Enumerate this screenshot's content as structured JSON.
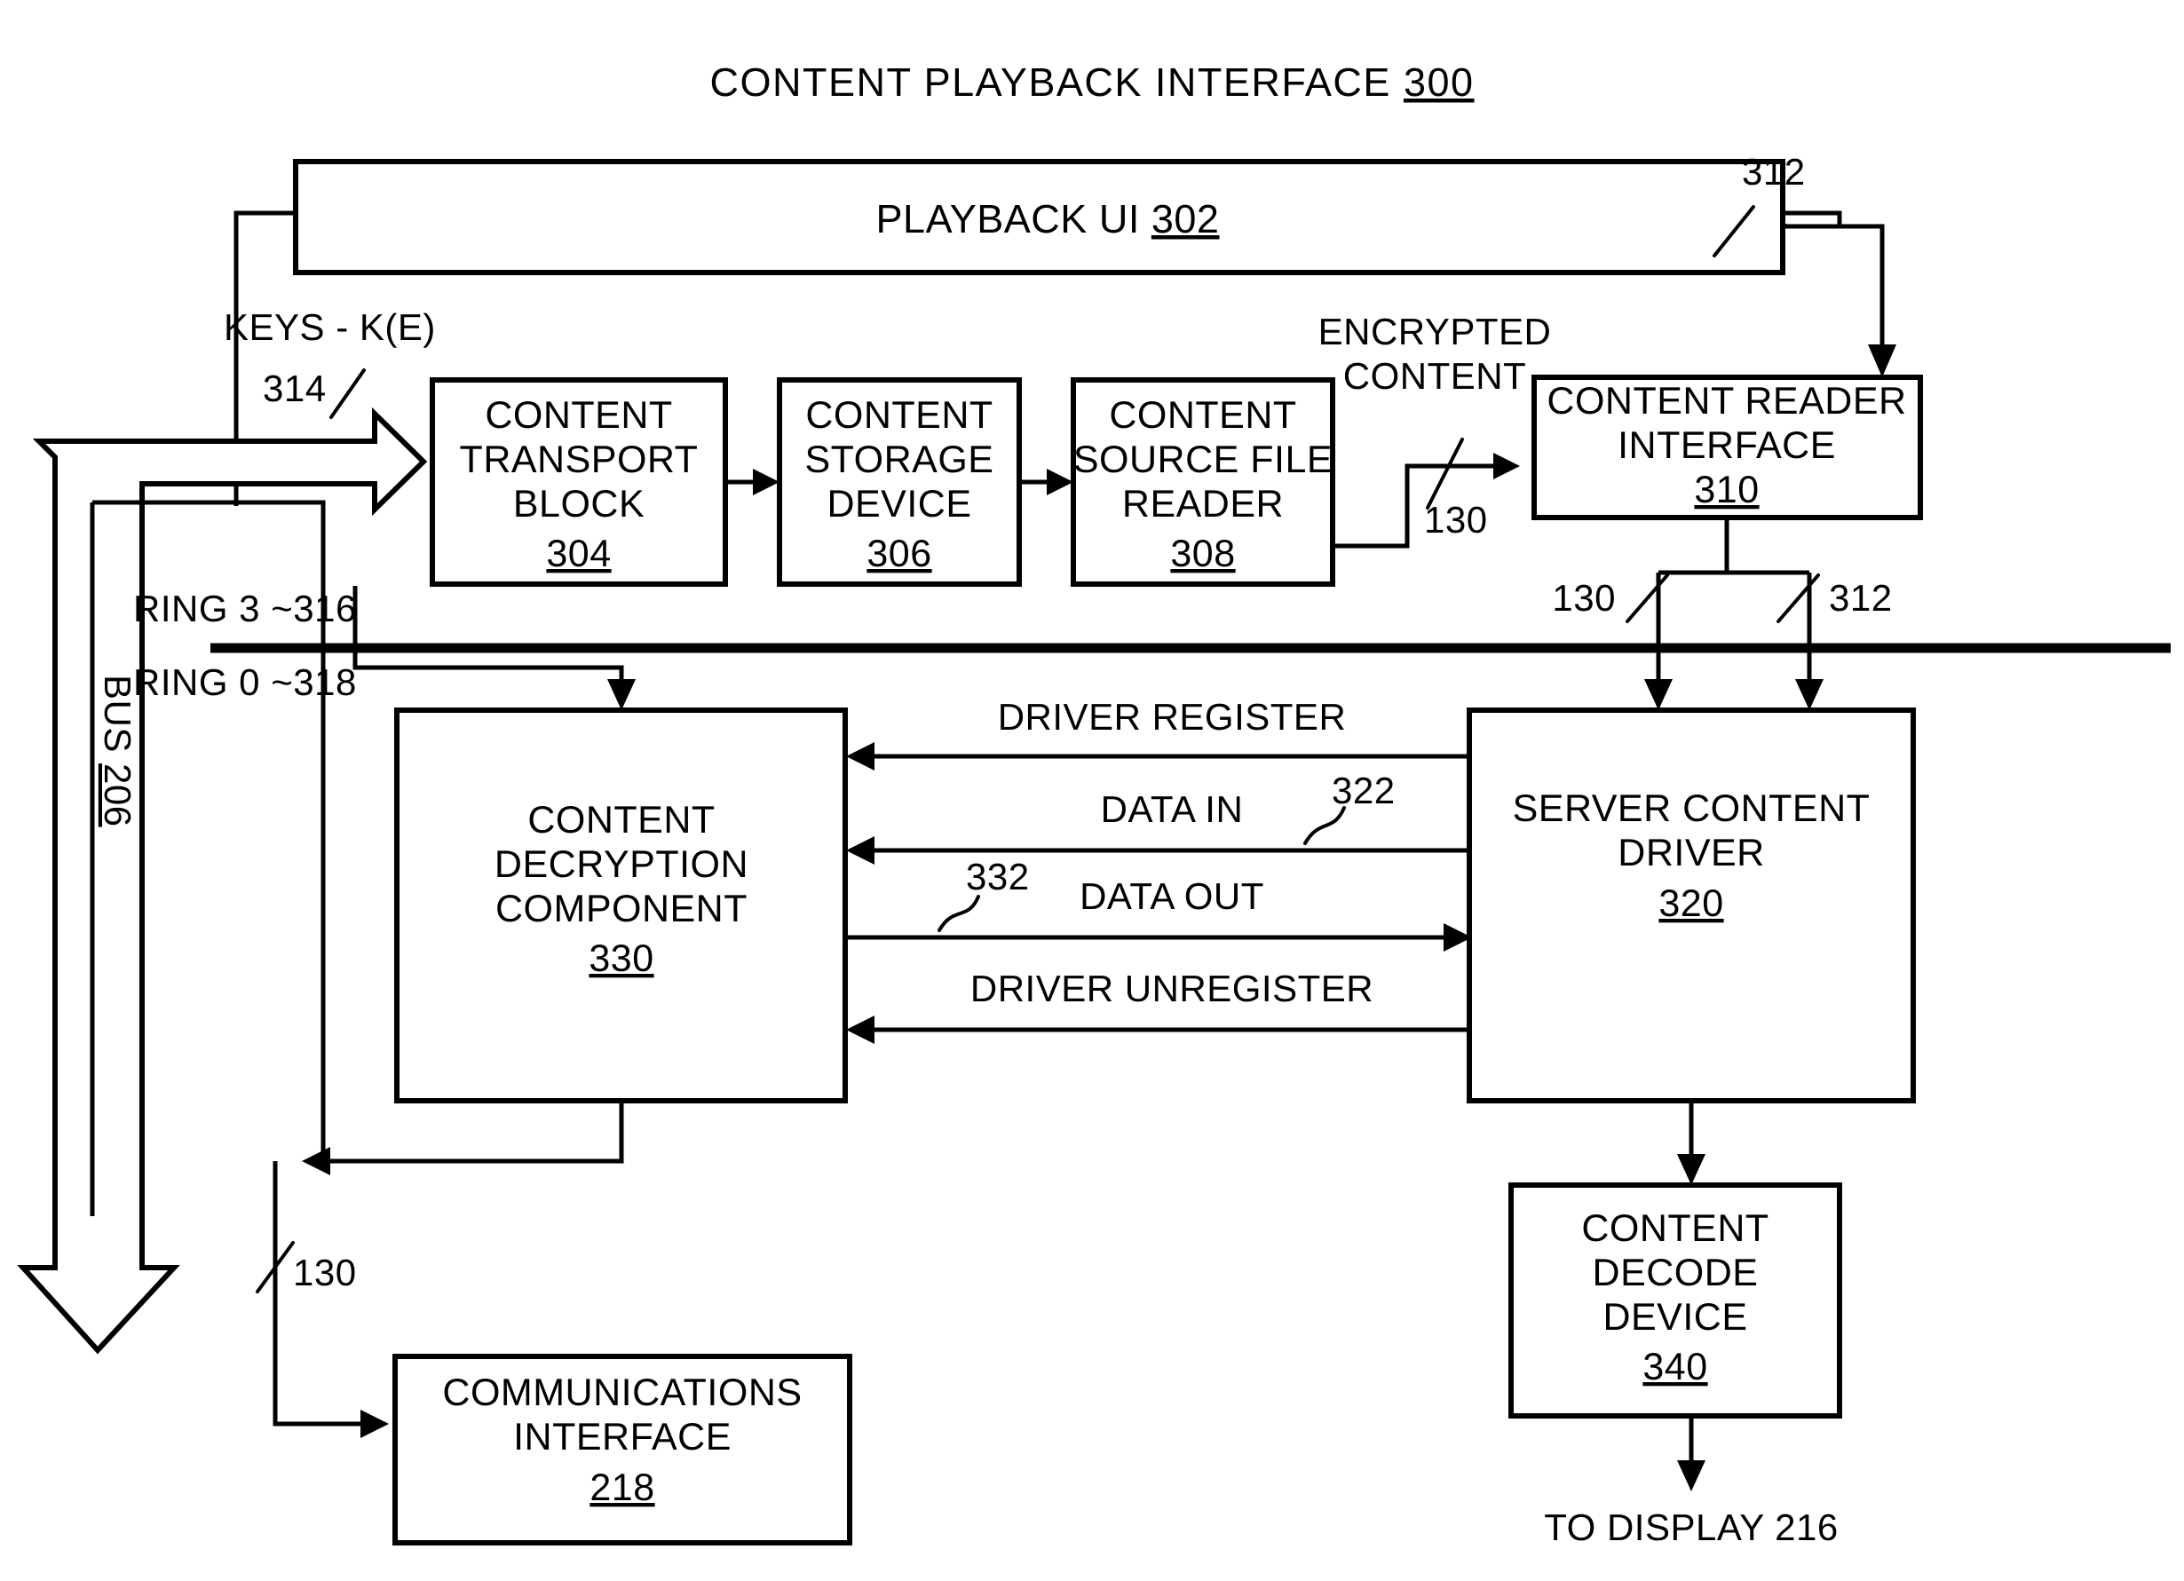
{
  "figure": {
    "title_text": "CONTENT PLAYBACK INTERFACE",
    "title_ref": "300"
  },
  "boxes": {
    "playback_ui": {
      "label": "PLAYBACK UI",
      "ref": "302"
    },
    "content_transport_block": {
      "line1": "CONTENT",
      "line2": "TRANSPORT",
      "line3": "BLOCK",
      "ref": "304"
    },
    "content_storage_device": {
      "line1": "CONTENT",
      "line2": "STORAGE",
      "line3": "DEVICE",
      "ref": "306"
    },
    "content_source_file_reader": {
      "line1": "CONTENT",
      "line2": "SOURCE FILE",
      "line3": "READER",
      "ref": "308"
    },
    "content_reader_interface": {
      "line1": "CONTENT READER",
      "line2": "INTERFACE",
      "ref": "310"
    },
    "content_decryption_component": {
      "line1": "CONTENT",
      "line2": "DECRYPTION",
      "line3": "COMPONENT",
      "ref": "330"
    },
    "server_content_driver": {
      "line1": "SERVER CONTENT",
      "line2": "DRIVER",
      "ref": "320"
    },
    "content_decode_device": {
      "line1": "CONTENT",
      "line2": "DECODE",
      "line3": "DEVICE",
      "ref": "340"
    },
    "communications_interface": {
      "line1": "COMMUNICATIONS",
      "line2": "INTERFACE",
      "ref": "218"
    }
  },
  "labels": {
    "keys": "KEYS - K(E)",
    "keys_ref": "314",
    "encrypted_content_l1": "ENCRYPTED",
    "encrypted_content_l2": "CONTENT",
    "encrypted_ref": "130",
    "playback_ui_ref_312": "312",
    "ring3": "RING 3 ~316",
    "ring0": "RING 0 ~318",
    "bus_text": "BUS",
    "bus_ref": "206",
    "driver_ref_130": "130",
    "driver_ref_312": "312",
    "comms_ref_130": "130",
    "to_display": "TO DISPLAY 216"
  },
  "signals": [
    {
      "name": "driver-register",
      "label": "DRIVER REGISTER",
      "direction": "left",
      "ref": ""
    },
    {
      "name": "data-in",
      "label": "DATA IN",
      "direction": "left",
      "ref": "322"
    },
    {
      "name": "data-out",
      "label": "DATA OUT",
      "direction": "right",
      "ref": "332"
    },
    {
      "name": "driver-unregister",
      "label": "DRIVER UNREGISTER",
      "direction": "left",
      "ref": ""
    }
  ],
  "colors": {
    "ink": "#000000",
    "paper": "#ffffff"
  }
}
